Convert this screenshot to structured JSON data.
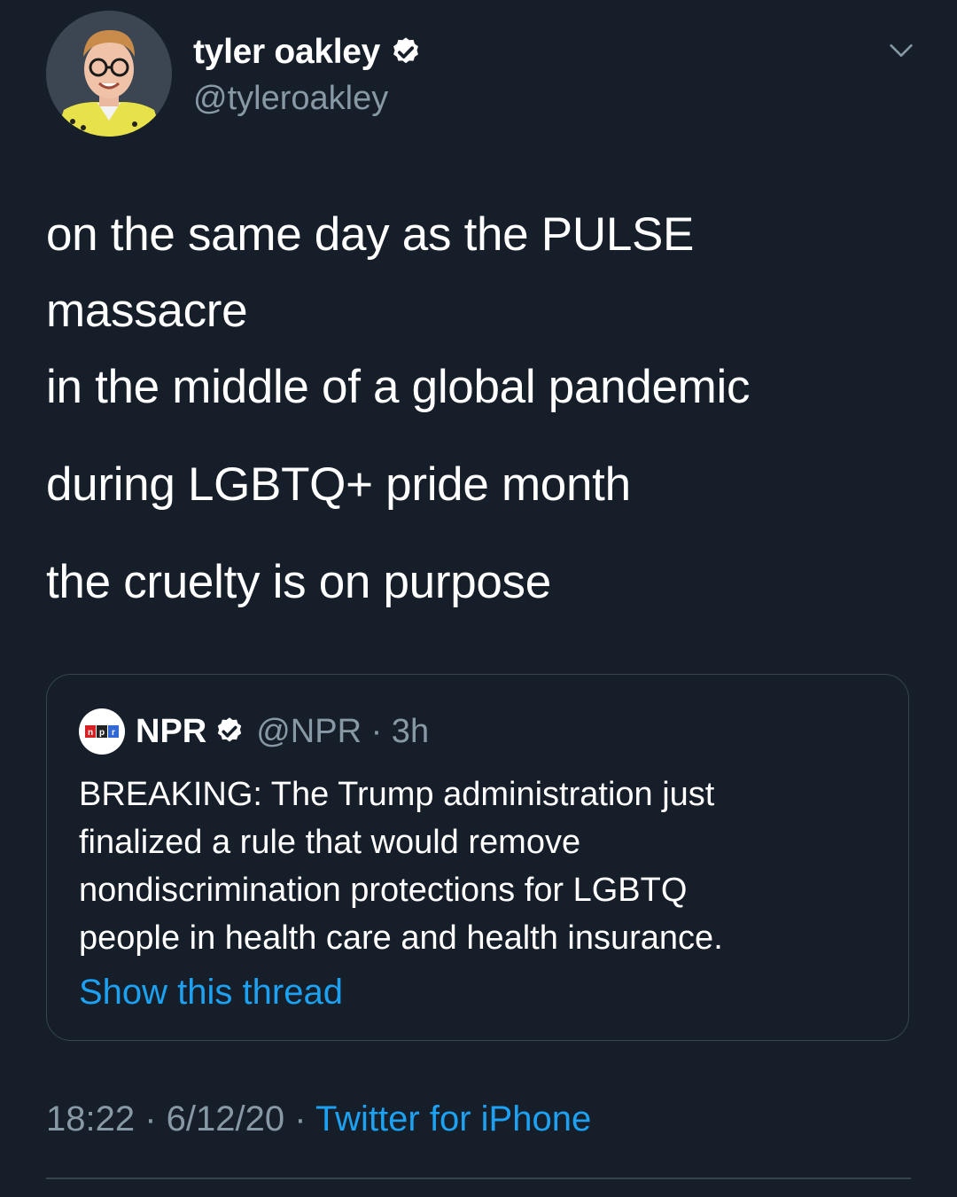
{
  "author": {
    "display_name": "tyler oakley",
    "handle": "@tyleroakley",
    "verified": true
  },
  "tweet": {
    "lines": [
      "on the same day as the PULSE",
      "massacre",
      "in the middle of a global pandemic",
      "during LGBTQ+ pride month",
      "the cruelty is on purpose"
    ]
  },
  "quoted_tweet": {
    "name": "NPR",
    "handle_time": "@NPR · 3h",
    "logo_text": "npr",
    "lines": [
      "BREAKING: The Trump administration just",
      "finalized a rule that would remove",
      "nondiscrimination protections for LGBTQ",
      "people in health care and health insurance."
    ],
    "show_thread": "Show this thread"
  },
  "footer": {
    "time_date": "18:22 · 6/12/20 · ",
    "source": "Twitter for iPhone"
  },
  "colors": {
    "background": "#161e29",
    "text": "#ffffff",
    "secondary": "#8899a6",
    "accent": "#1da1f2",
    "border": "#38444d"
  },
  "icons": [
    "avatar",
    "verified-badge-icon",
    "chevron-down-icon",
    "npr-logo"
  ]
}
